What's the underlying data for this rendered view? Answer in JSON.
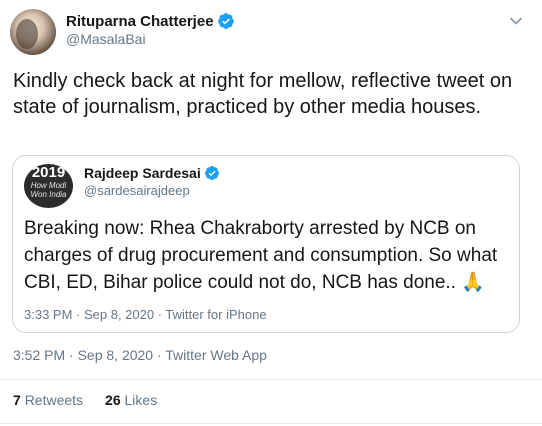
{
  "author": {
    "name": "Rituparna Chatterjee",
    "handle": "@MasalaBai"
  },
  "tweet": {
    "text": "Kindly check back at night for mellow, reflective tweet on state of journalism, practiced by other media houses."
  },
  "quoted": {
    "name": "Rajdeep Sardesai",
    "handle": "@sardesairajdeep",
    "avatar_text_1": "2019",
    "avatar_text_2": "How Modi Won India",
    "text": "Breaking now: Rhea Chakraborty arrested by NCB on charges of drug procurement and consumption. So what CBI, ED, Bihar police could not do, NCB has done.. 🙏",
    "meta": "3:33 PM · Sep 8, 2020 · Twitter for iPhone"
  },
  "meta": "3:52 PM · Sep 8, 2020 · Twitter Web App",
  "stats": {
    "retweets_count": "7",
    "retweets_label": "Retweets",
    "likes_count": "26",
    "likes_label": "Likes"
  },
  "colors": {
    "verified": "#1da1f2",
    "secondary_text": "#657786"
  }
}
